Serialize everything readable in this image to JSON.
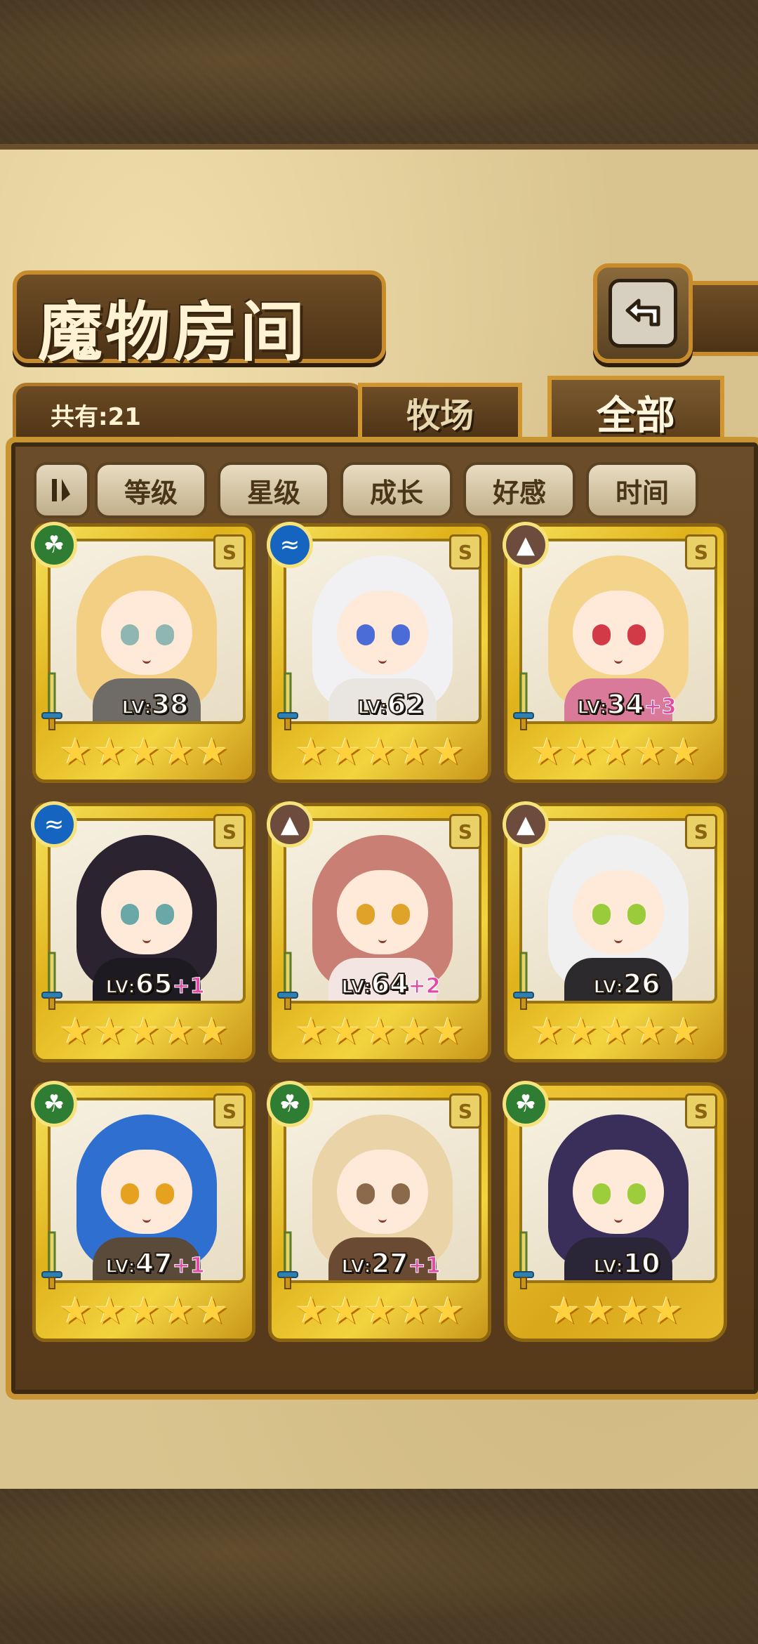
{
  "header": {
    "title": "魔物房间",
    "back_icon": "return-arrow-icon"
  },
  "count": {
    "label": "共有:21"
  },
  "tabs": [
    {
      "label": "牧场",
      "active": false
    },
    {
      "label": "全部",
      "active": true
    }
  ],
  "sort": {
    "toggle_icon": "sort-order-icon",
    "buttons": [
      "等级",
      "星级",
      "成长",
      "好感",
      "时间"
    ]
  },
  "monsters": [
    {
      "element": "grass",
      "rank": "S",
      "level": "38",
      "plus": "",
      "stars": 5,
      "hair": "#f3cf84",
      "eye": "#8fb6b0",
      "outfit": "#6f6b66"
    },
    {
      "element": "water",
      "rank": "S",
      "level": "62",
      "plus": "",
      "stars": 5,
      "hair": "#f1f1f4",
      "eye": "#4b6bd6",
      "outfit": "#e9e6e2"
    },
    {
      "element": "rock",
      "rank": "S",
      "level": "34",
      "plus": "+3",
      "stars": 5,
      "hair": "#f4d38b",
      "eye": "#d33a48",
      "outfit": "#d97a9a"
    },
    {
      "element": "water",
      "rank": "S",
      "level": "65",
      "plus": "+1",
      "stars": 5,
      "hair": "#2b2430",
      "eye": "#6aa8a8",
      "outfit": "#1e1a22"
    },
    {
      "element": "rock",
      "rank": "S",
      "level": "64",
      "plus": "+2",
      "stars": 5,
      "hair": "#c97f74",
      "eye": "#e0a32a",
      "outfit": "#f3e6e2"
    },
    {
      "element": "rock",
      "rank": "S",
      "level": "26",
      "plus": "",
      "stars": 5,
      "hair": "#f0f0f0",
      "eye": "#9acb3a",
      "outfit": "#2d2a2e"
    },
    {
      "element": "grass",
      "rank": "S",
      "level": "47",
      "plus": "+1",
      "stars": 5,
      "hair": "#2f6fd0",
      "eye": "#e6a21e",
      "outfit": "#5a4a3a"
    },
    {
      "element": "grass",
      "rank": "S",
      "level": "27",
      "plus": "+1",
      "stars": 5,
      "hair": "#ead3a6",
      "eye": "#8a6a4a",
      "outfit": "#6a4a33"
    },
    {
      "element": "grass",
      "rank": "S",
      "level": "10",
      "plus": "",
      "stars": 4,
      "hair": "#3a2f5a",
      "eye": "#9ccd3b",
      "outfit": "#2a2638"
    }
  ],
  "labels": {
    "lv_prefix": "LV:"
  }
}
